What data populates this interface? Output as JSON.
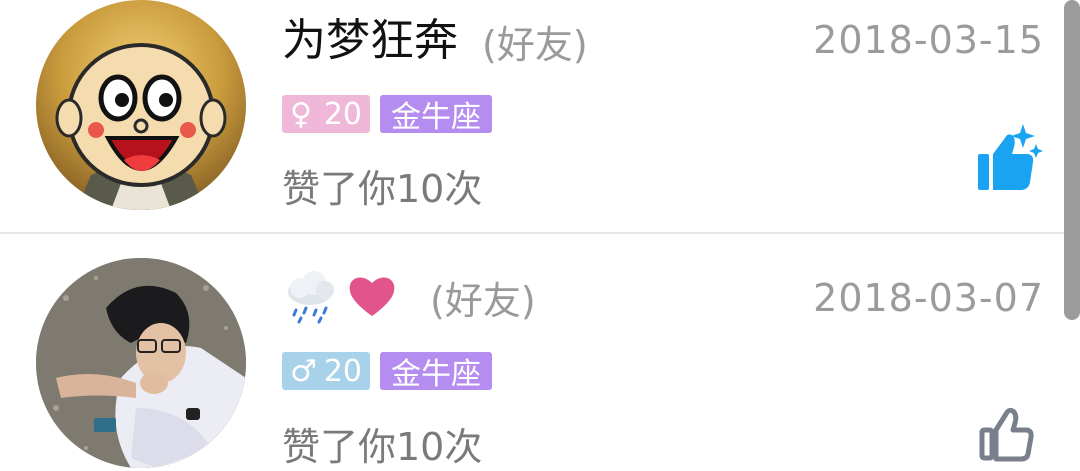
{
  "items": [
    {
      "name": "为梦狂奔",
      "relation": "(好友)",
      "date": "2018-03-15",
      "gender_symbol": "♀",
      "age": "20",
      "zodiac": "金牛座",
      "action": "赞了你10次",
      "like_state": "liked",
      "like_color": "#1aa3f0"
    },
    {
      "name_icons": [
        "rain-cloud-icon",
        "heart-icon"
      ],
      "relation": "(好友)",
      "date": "2018-03-07",
      "gender_symbol": "♂",
      "age": "20",
      "zodiac": "金牛座",
      "action": "赞了你10次",
      "like_state": "unliked",
      "like_color": "#7a7f8c"
    }
  ],
  "colors": {
    "female_badge": "#f0b8d8",
    "male_badge": "#a8d2ea",
    "zodiac_badge": "#b58df0",
    "heart": "#e2558c"
  }
}
